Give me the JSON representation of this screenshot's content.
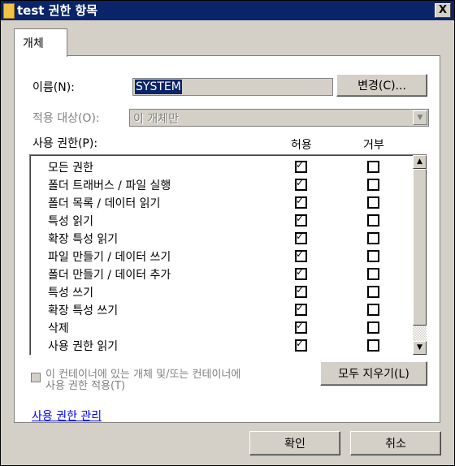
{
  "window": {
    "title": "test 권한 항목",
    "close_label": "X"
  },
  "tab": {
    "label": "개체"
  },
  "name_row": {
    "label": "이름(N):",
    "value": "SYSTEM",
    "change_button": "변경(C)..."
  },
  "apply_row": {
    "label": "적용 대상(O):",
    "value": "이 개체만"
  },
  "permissions": {
    "label": "사용 권한(P):",
    "col_allow": "허용",
    "col_deny": "거부",
    "rows": [
      {
        "name": "모든 권한",
        "allow": true,
        "deny": false
      },
      {
        "name": "폴더 트래버스 / 파일 실행",
        "allow": true,
        "deny": false
      },
      {
        "name": "폴더 목록 / 데이터 읽기",
        "allow": true,
        "deny": false
      },
      {
        "name": "특성 읽기",
        "allow": true,
        "deny": false
      },
      {
        "name": "확장 특성 읽기",
        "allow": true,
        "deny": false
      },
      {
        "name": "파일 만들기 / 데이터 쓰기",
        "allow": true,
        "deny": false
      },
      {
        "name": "폴더 만들기 / 데이터 추가",
        "allow": true,
        "deny": false
      },
      {
        "name": "특성 쓰기",
        "allow": true,
        "deny": false
      },
      {
        "name": "확장 특성 쓰기",
        "allow": true,
        "deny": false
      },
      {
        "name": "삭제",
        "allow": true,
        "deny": false
      },
      {
        "name": "사용 권한 읽기",
        "allow": true,
        "deny": false
      }
    ]
  },
  "inherit_checkbox": {
    "line1": "이 컨테이너에 있는 개체 및/또는 컨테이너에",
    "line2": "사용 권한 적용(T)",
    "checked": false
  },
  "clear_all_button": "모두 지우기(L)",
  "manage_link": "사용 권한 관리",
  "footer": {
    "ok": "확인",
    "cancel": "취소"
  }
}
